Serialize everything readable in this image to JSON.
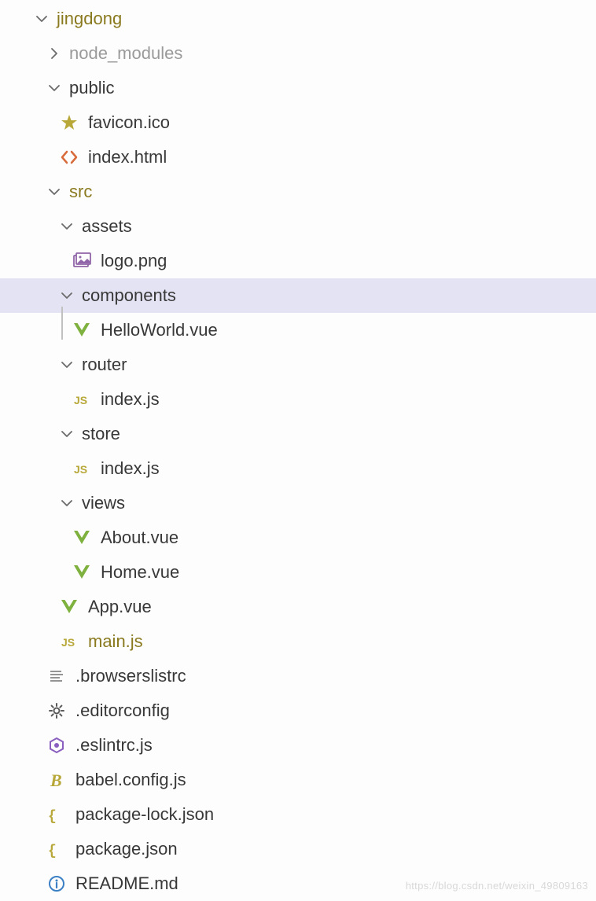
{
  "tree": {
    "root": {
      "label": "jingdong"
    },
    "nodeModules": {
      "label": "node_modules"
    },
    "public": {
      "label": "public"
    },
    "favicon": {
      "label": "favicon.ico"
    },
    "indexHtml": {
      "label": "index.html"
    },
    "src": {
      "label": "src"
    },
    "assets": {
      "label": "assets"
    },
    "logoPng": {
      "label": "logo.png"
    },
    "components": {
      "label": "components"
    },
    "helloWorld": {
      "label": "HelloWorld.vue"
    },
    "router": {
      "label": "router"
    },
    "routerIndex": {
      "label": "index.js"
    },
    "store": {
      "label": "store"
    },
    "storeIndex": {
      "label": "index.js"
    },
    "views": {
      "label": "views"
    },
    "aboutVue": {
      "label": "About.vue"
    },
    "homeVue": {
      "label": "Home.vue"
    },
    "appVue": {
      "label": "App.vue"
    },
    "mainJs": {
      "label": "main.js"
    },
    "browserslist": {
      "label": ".browserslistrc"
    },
    "editorconfig": {
      "label": ".editorconfig"
    },
    "eslintrc": {
      "label": ".eslintrc.js"
    },
    "babelConfig": {
      "label": "babel.config.js"
    },
    "packageLock": {
      "label": "package-lock.json"
    },
    "packageJson": {
      "label": "package.json"
    },
    "readme": {
      "label": "README.md"
    }
  },
  "watermark": "https://blog.csdn.net/weixin_49809163"
}
